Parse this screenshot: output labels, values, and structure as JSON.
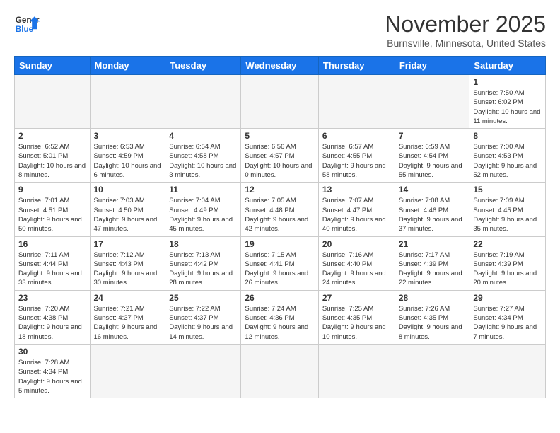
{
  "header": {
    "logo_text_general": "General",
    "logo_text_blue": "Blue",
    "month_title": "November 2025",
    "location": "Burnsville, Minnesota, United States"
  },
  "weekdays": [
    "Sunday",
    "Monday",
    "Tuesday",
    "Wednesday",
    "Thursday",
    "Friday",
    "Saturday"
  ],
  "weeks": [
    [
      {
        "day": null,
        "info": null
      },
      {
        "day": null,
        "info": null
      },
      {
        "day": null,
        "info": null
      },
      {
        "day": null,
        "info": null
      },
      {
        "day": null,
        "info": null
      },
      {
        "day": null,
        "info": null
      },
      {
        "day": "1",
        "info": "Sunrise: 7:50 AM\nSunset: 6:02 PM\nDaylight: 10 hours and 11 minutes."
      }
    ],
    [
      {
        "day": "2",
        "info": "Sunrise: 6:52 AM\nSunset: 5:01 PM\nDaylight: 10 hours and 8 minutes."
      },
      {
        "day": "3",
        "info": "Sunrise: 6:53 AM\nSunset: 4:59 PM\nDaylight: 10 hours and 6 minutes."
      },
      {
        "day": "4",
        "info": "Sunrise: 6:54 AM\nSunset: 4:58 PM\nDaylight: 10 hours and 3 minutes."
      },
      {
        "day": "5",
        "info": "Sunrise: 6:56 AM\nSunset: 4:57 PM\nDaylight: 10 hours and 0 minutes."
      },
      {
        "day": "6",
        "info": "Sunrise: 6:57 AM\nSunset: 4:55 PM\nDaylight: 9 hours and 58 minutes."
      },
      {
        "day": "7",
        "info": "Sunrise: 6:59 AM\nSunset: 4:54 PM\nDaylight: 9 hours and 55 minutes."
      },
      {
        "day": "8",
        "info": "Sunrise: 7:00 AM\nSunset: 4:53 PM\nDaylight: 9 hours and 52 minutes."
      }
    ],
    [
      {
        "day": "9",
        "info": "Sunrise: 7:01 AM\nSunset: 4:51 PM\nDaylight: 9 hours and 50 minutes."
      },
      {
        "day": "10",
        "info": "Sunrise: 7:03 AM\nSunset: 4:50 PM\nDaylight: 9 hours and 47 minutes."
      },
      {
        "day": "11",
        "info": "Sunrise: 7:04 AM\nSunset: 4:49 PM\nDaylight: 9 hours and 45 minutes."
      },
      {
        "day": "12",
        "info": "Sunrise: 7:05 AM\nSunset: 4:48 PM\nDaylight: 9 hours and 42 minutes."
      },
      {
        "day": "13",
        "info": "Sunrise: 7:07 AM\nSunset: 4:47 PM\nDaylight: 9 hours and 40 minutes."
      },
      {
        "day": "14",
        "info": "Sunrise: 7:08 AM\nSunset: 4:46 PM\nDaylight: 9 hours and 37 minutes."
      },
      {
        "day": "15",
        "info": "Sunrise: 7:09 AM\nSunset: 4:45 PM\nDaylight: 9 hours and 35 minutes."
      }
    ],
    [
      {
        "day": "16",
        "info": "Sunrise: 7:11 AM\nSunset: 4:44 PM\nDaylight: 9 hours and 33 minutes."
      },
      {
        "day": "17",
        "info": "Sunrise: 7:12 AM\nSunset: 4:43 PM\nDaylight: 9 hours and 30 minutes."
      },
      {
        "day": "18",
        "info": "Sunrise: 7:13 AM\nSunset: 4:42 PM\nDaylight: 9 hours and 28 minutes."
      },
      {
        "day": "19",
        "info": "Sunrise: 7:15 AM\nSunset: 4:41 PM\nDaylight: 9 hours and 26 minutes."
      },
      {
        "day": "20",
        "info": "Sunrise: 7:16 AM\nSunset: 4:40 PM\nDaylight: 9 hours and 24 minutes."
      },
      {
        "day": "21",
        "info": "Sunrise: 7:17 AM\nSunset: 4:39 PM\nDaylight: 9 hours and 22 minutes."
      },
      {
        "day": "22",
        "info": "Sunrise: 7:19 AM\nSunset: 4:39 PM\nDaylight: 9 hours and 20 minutes."
      }
    ],
    [
      {
        "day": "23",
        "info": "Sunrise: 7:20 AM\nSunset: 4:38 PM\nDaylight: 9 hours and 18 minutes."
      },
      {
        "day": "24",
        "info": "Sunrise: 7:21 AM\nSunset: 4:37 PM\nDaylight: 9 hours and 16 minutes."
      },
      {
        "day": "25",
        "info": "Sunrise: 7:22 AM\nSunset: 4:37 PM\nDaylight: 9 hours and 14 minutes."
      },
      {
        "day": "26",
        "info": "Sunrise: 7:24 AM\nSunset: 4:36 PM\nDaylight: 9 hours and 12 minutes."
      },
      {
        "day": "27",
        "info": "Sunrise: 7:25 AM\nSunset: 4:35 PM\nDaylight: 9 hours and 10 minutes."
      },
      {
        "day": "28",
        "info": "Sunrise: 7:26 AM\nSunset: 4:35 PM\nDaylight: 9 hours and 8 minutes."
      },
      {
        "day": "29",
        "info": "Sunrise: 7:27 AM\nSunset: 4:34 PM\nDaylight: 9 hours and 7 minutes."
      }
    ],
    [
      {
        "day": "30",
        "info": "Sunrise: 7:28 AM\nSunset: 4:34 PM\nDaylight: 9 hours and 5 minutes."
      },
      {
        "day": null,
        "info": null
      },
      {
        "day": null,
        "info": null
      },
      {
        "day": null,
        "info": null
      },
      {
        "day": null,
        "info": null
      },
      {
        "day": null,
        "info": null
      },
      {
        "day": null,
        "info": null
      }
    ]
  ]
}
